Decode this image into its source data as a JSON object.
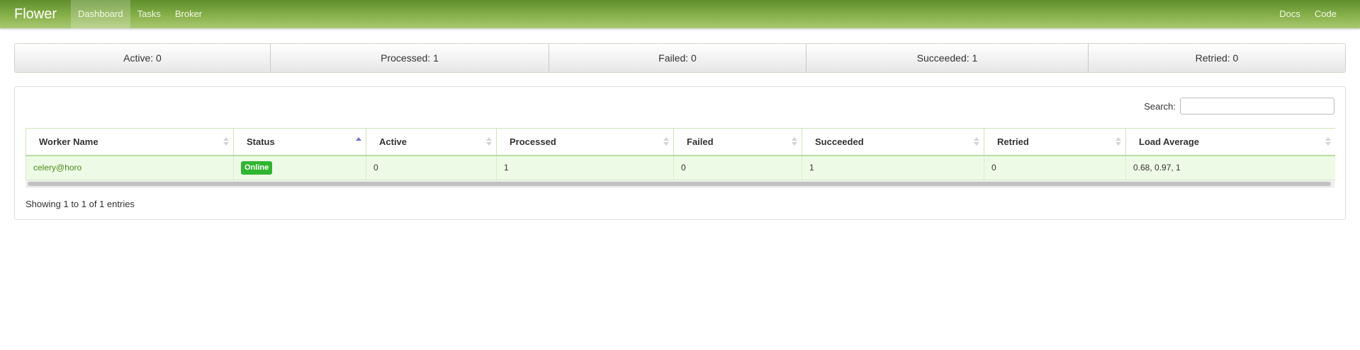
{
  "navbar": {
    "brand": "Flower",
    "left_links": [
      "Dashboard",
      "Tasks",
      "Broker"
    ],
    "active": "Dashboard",
    "right_links": [
      "Docs",
      "Code"
    ]
  },
  "stats": {
    "active": "Active: 0",
    "processed": "Processed: 1",
    "failed": "Failed: 0",
    "succeeded": "Succeeded: 1",
    "retried": "Retried: 0"
  },
  "search": {
    "label": "Search:",
    "value": ""
  },
  "table": {
    "columns": [
      "Worker Name",
      "Status",
      "Active",
      "Processed",
      "Failed",
      "Succeeded",
      "Retried",
      "Load Average"
    ],
    "sorted_column": "Status",
    "sort_direction": "ascending",
    "rows": [
      {
        "worker_name": "celery@horo",
        "status": "Online",
        "active": "0",
        "processed": "1",
        "failed": "0",
        "succeeded": "1",
        "retried": "0",
        "load_average": "0.68, 0.97, 1"
      }
    ]
  },
  "info": "Showing 1 to 1 of 1 entries",
  "colors": {
    "navbar_accent": "#87b04a",
    "online_badge": "#2fb52f",
    "row_background": "#edfbe6",
    "sort_active": "#6a72d8"
  }
}
